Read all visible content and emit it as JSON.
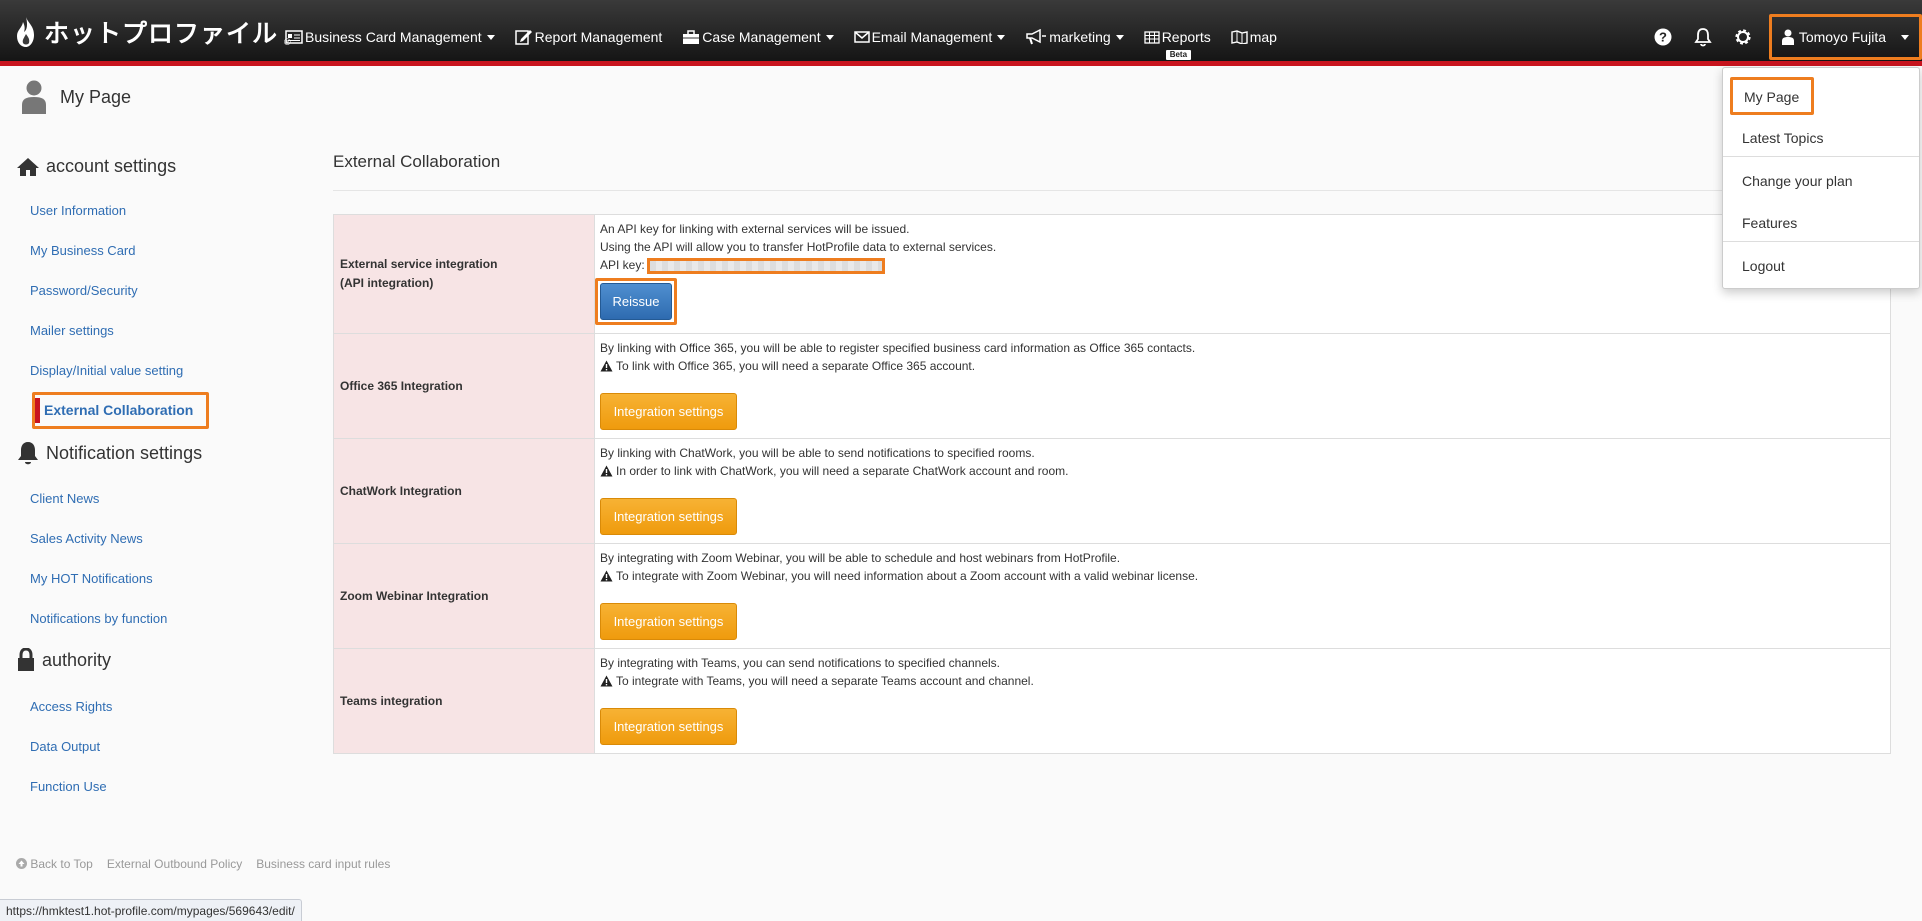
{
  "brand": {
    "logo_text": "ホットプロファイル",
    "registered_mark": "®"
  },
  "nav": {
    "items": [
      {
        "label": "Business Card Management",
        "icon": "business-card-icon",
        "has_caret": true
      },
      {
        "label": "Report Management",
        "icon": "report-icon",
        "has_caret": false
      },
      {
        "label": "Case Management",
        "icon": "briefcase-icon",
        "has_caret": true
      },
      {
        "label": "Email Management",
        "icon": "envelope-icon",
        "has_caret": true
      },
      {
        "label": "marketing",
        "icon": "megaphone-icon",
        "has_caret": true
      },
      {
        "label": "Reports",
        "icon": "table-icon",
        "has_caret": false,
        "badge": "Beta"
      },
      {
        "label": "map",
        "icon": "map-icon",
        "has_caret": false
      }
    ],
    "user_name": "Tomoyo Fujita"
  },
  "user_dropdown": {
    "items": [
      "My Page",
      "Latest Topics",
      "Change your plan",
      "Features",
      "Logout"
    ]
  },
  "page": {
    "title": "My Page"
  },
  "sidebar": {
    "account_settings": {
      "heading": "account settings",
      "links": [
        "User Information",
        "My Business Card",
        "Password/Security",
        "Mailer settings",
        "Display/Initial value setting",
        "External Collaboration"
      ]
    },
    "notification_settings": {
      "heading": "Notification settings",
      "links": [
        "Client News",
        "Sales Activity News",
        "My HOT Notifications",
        "Notifications by function"
      ]
    },
    "authority": {
      "heading": "authority",
      "links": [
        "Access Rights",
        "Data Output",
        "Function Use"
      ]
    }
  },
  "main": {
    "section_title": "External Collaboration",
    "rows": [
      {
        "label_lines": [
          "External service integration",
          "(API integration)"
        ],
        "lines": [
          "An API key for linking with external services will be issued.",
          "Using the API will allow you to transfer HotProfile data to external services."
        ],
        "api_key_label": "API key:",
        "button": "Reissue"
      },
      {
        "label_lines": [
          "Office 365 Integration"
        ],
        "lines": [
          "By linking with Office 365, you will be able to register specified business card information as Office 365 contacts."
        ],
        "warning": "To link with Office 365, you will need a separate Office 365 account.",
        "button": "Integration settings"
      },
      {
        "label_lines": [
          "ChatWork Integration"
        ],
        "lines": [
          "By linking with ChatWork, you will be able to send notifications to specified rooms."
        ],
        "warning": "In order to link with ChatWork, you will need a separate ChatWork account and room.",
        "button": "Integration settings"
      },
      {
        "label_lines": [
          "Zoom Webinar Integration"
        ],
        "lines": [
          "By integrating with Zoom Webinar, you will be able to schedule and host webinars from HotProfile."
        ],
        "warning": "To integrate with Zoom Webinar, you will need information about a Zoom account with a valid webinar license.",
        "button": "Integration settings"
      },
      {
        "label_lines": [
          "Teams integration"
        ],
        "lines": [
          "By integrating with Teams, you can send notifications to specified channels."
        ],
        "warning": "To integrate with Teams, you will need a separate Teams account and channel.",
        "button": "Integration settings"
      }
    ]
  },
  "footer": {
    "links": [
      "Back to Top",
      "External Outbound Policy",
      "Business card input rules"
    ]
  },
  "status_bar": {
    "url": "https://hmktest1.hot-profile.com/mypages/569643/edit/"
  },
  "colors": {
    "accent_red": "#c8141e",
    "highlight_orange": "#ee7d1f",
    "button_orange": "#f0a21a",
    "button_blue": "#3a7bc0",
    "link_blue": "#2f6db3",
    "label_bg": "#f7e4e5"
  }
}
